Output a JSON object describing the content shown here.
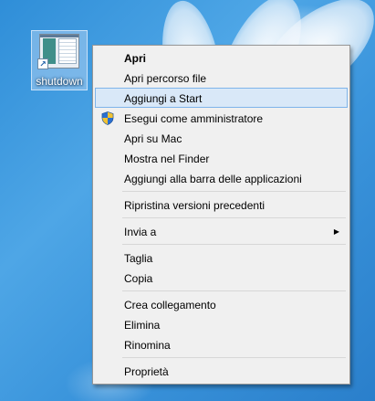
{
  "desktop": {
    "icon": {
      "label": "shutdown",
      "icon_name": "shortcut-window-icon"
    }
  },
  "context_menu": {
    "items": [
      {
        "type": "item",
        "label": "Apri",
        "bold": true
      },
      {
        "type": "item",
        "label": "Apri percorso file"
      },
      {
        "type": "item",
        "label": "Aggiungi a Start",
        "highlighted": true
      },
      {
        "type": "item",
        "label": "Esegui come amministratore",
        "icon": "uac-shield-icon"
      },
      {
        "type": "item",
        "label": "Apri su Mac"
      },
      {
        "type": "item",
        "label": "Mostra nel Finder"
      },
      {
        "type": "item",
        "label": "Aggiungi alla barra delle applicazioni"
      },
      {
        "type": "separator"
      },
      {
        "type": "item",
        "label": "Ripristina versioni precedenti"
      },
      {
        "type": "separator"
      },
      {
        "type": "item",
        "label": "Invia a",
        "submenu": true
      },
      {
        "type": "separator"
      },
      {
        "type": "item",
        "label": "Taglia"
      },
      {
        "type": "item",
        "label": "Copia"
      },
      {
        "type": "separator"
      },
      {
        "type": "item",
        "label": "Crea collegamento"
      },
      {
        "type": "item",
        "label": "Elimina"
      },
      {
        "type": "item",
        "label": "Rinomina"
      },
      {
        "type": "separator"
      },
      {
        "type": "item",
        "label": "Proprietà"
      }
    ]
  },
  "colors": {
    "menu_background": "#f0f0f0",
    "highlight_background": "#d9e8f8",
    "highlight_border": "#7eb4ea",
    "desktop_blue": "#3b95dc"
  }
}
